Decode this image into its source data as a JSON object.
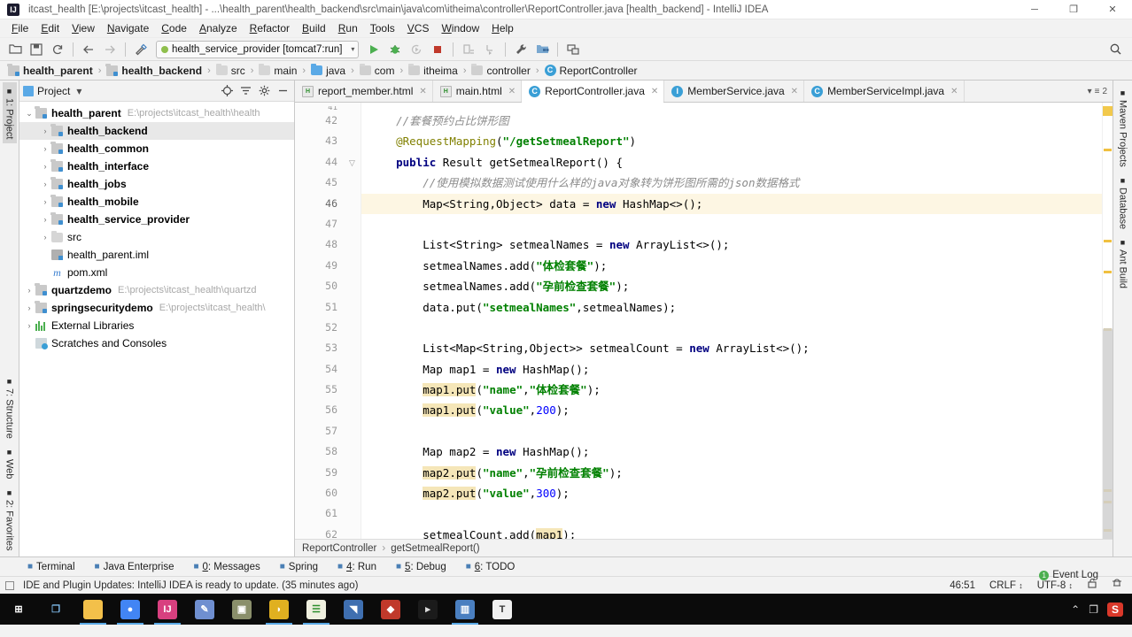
{
  "window": {
    "title": "itcast_health [E:\\projects\\itcast_health] - ...\\health_parent\\health_backend\\src\\main\\java\\com\\itheima\\controller\\ReportController.java [health_backend] - IntelliJ IDEA",
    "logo_text": "IJ",
    "minimize": "─",
    "maximize": "❐",
    "close": "✕"
  },
  "menu": [
    {
      "label": "File"
    },
    {
      "label": "Edit"
    },
    {
      "label": "View"
    },
    {
      "label": "Navigate"
    },
    {
      "label": "Code"
    },
    {
      "label": "Analyze"
    },
    {
      "label": "Refactor"
    },
    {
      "label": "Build"
    },
    {
      "label": "Run"
    },
    {
      "label": "Tools"
    },
    {
      "label": "VCS"
    },
    {
      "label": "Window"
    },
    {
      "label": "Help"
    }
  ],
  "toolbar": {
    "open_icon": "open-folder-icon",
    "save_icon": "save-all-icon",
    "sync_icon": "synchronize-icon",
    "back_icon": "back-arrow-icon",
    "forward_icon": "forward-arrow-icon",
    "build_icon": "build-hammer-icon",
    "run_config": "health_service_provider [tomcat7:run]",
    "run_icon": "run-icon",
    "debug_icon": "debug-icon",
    "run_coverage_icon": "run-with-coverage-icon",
    "stop_icon": "stop-icon",
    "update_app_icon": "update-application-icon",
    "profile_icon": "profile-icon",
    "settings_icon": "settings-wrench-icon",
    "project_structure_icon": "project-structure-icon",
    "sdk_icon": "sdk-manager-icon",
    "search_icon": "search-everywhere-icon"
  },
  "breadcrumbs": [
    {
      "label": "health_parent",
      "icon": "module-icon",
      "bold": true
    },
    {
      "label": "health_backend",
      "icon": "module-icon",
      "bold": true
    },
    {
      "label": "src",
      "icon": "folder-icon",
      "bold": false
    },
    {
      "label": "main",
      "icon": "folder-icon",
      "bold": false
    },
    {
      "label": "java",
      "icon": "source-folder-icon",
      "bold": false
    },
    {
      "label": "com",
      "icon": "package-icon",
      "bold": false
    },
    {
      "label": "itheima",
      "icon": "package-icon",
      "bold": false
    },
    {
      "label": "controller",
      "icon": "package-icon",
      "bold": false
    },
    {
      "label": "ReportController",
      "icon": "class-icon",
      "bold": false
    }
  ],
  "left_strip": {
    "top": [
      {
        "label": "1: Project",
        "icon": "project-icon",
        "active": true
      }
    ],
    "bottom": [
      {
        "label": "2: Favorites",
        "icon": "star-icon",
        "active": false
      },
      {
        "label": "Web",
        "icon": "web-icon",
        "active": false
      },
      {
        "label": "7: Structure",
        "icon": "structure-icon",
        "active": false
      }
    ]
  },
  "right_strip": [
    {
      "label": "Maven Projects",
      "icon": "maven-icon"
    },
    {
      "label": "Database",
      "icon": "database-icon"
    },
    {
      "label": "Ant Build",
      "icon": "ant-icon"
    }
  ],
  "project_panel": {
    "title": "Project",
    "title_caret": "▾",
    "buttons": [
      {
        "name": "locate-icon",
        "glyph": "⌘"
      },
      {
        "name": "collapse-all-icon",
        "glyph": "≡"
      },
      {
        "name": "settings-gear-icon",
        "glyph": "⚙"
      },
      {
        "name": "hide-icon",
        "glyph": "─"
      }
    ],
    "tree": [
      {
        "depth": 0,
        "arrow": "⌄",
        "icon": "module-icon",
        "label": "health_parent",
        "bold": true,
        "path": "E:\\projects\\itcast_health\\health",
        "selected": false
      },
      {
        "depth": 1,
        "arrow": "›",
        "icon": "module-icon",
        "label": "health_backend",
        "bold": true,
        "path": "",
        "selected": true
      },
      {
        "depth": 1,
        "arrow": "›",
        "icon": "module-icon",
        "label": "health_common",
        "bold": true,
        "path": "",
        "selected": false
      },
      {
        "depth": 1,
        "arrow": "›",
        "icon": "module-icon",
        "label": "health_interface",
        "bold": true,
        "path": "",
        "selected": false
      },
      {
        "depth": 1,
        "arrow": "›",
        "icon": "module-icon",
        "label": "health_jobs",
        "bold": true,
        "path": "",
        "selected": false
      },
      {
        "depth": 1,
        "arrow": "›",
        "icon": "module-icon",
        "label": "health_mobile",
        "bold": true,
        "path": "",
        "selected": false
      },
      {
        "depth": 1,
        "arrow": "›",
        "icon": "module-icon",
        "label": "health_service_provider",
        "bold": true,
        "path": "",
        "selected": false
      },
      {
        "depth": 1,
        "arrow": "›",
        "icon": "folder-icon",
        "label": "src",
        "bold": false,
        "path": "",
        "selected": false
      },
      {
        "depth": 1,
        "arrow": "",
        "icon": "iml-icon",
        "label": "health_parent.iml",
        "bold": false,
        "path": "",
        "selected": false
      },
      {
        "depth": 1,
        "arrow": "",
        "icon": "xml-icon",
        "label": "pom.xml",
        "bold": false,
        "path": "",
        "selected": false
      },
      {
        "depth": 0,
        "arrow": "›",
        "icon": "module-icon",
        "label": "quartzdemo",
        "bold": true,
        "path": "E:\\projects\\itcast_health\\quartzd",
        "selected": false
      },
      {
        "depth": 0,
        "arrow": "›",
        "icon": "module-icon",
        "label": "springsecuritydemo",
        "bold": true,
        "path": "E:\\projects\\itcast_health\\",
        "selected": false
      },
      {
        "depth": 0,
        "arrow": "›",
        "icon": "library-icon",
        "label": "External Libraries",
        "bold": false,
        "path": "",
        "selected": false
      },
      {
        "depth": 0,
        "arrow": "",
        "icon": "scratches-icon",
        "label": "Scratches and Consoles",
        "bold": false,
        "path": "",
        "selected": false
      }
    ]
  },
  "editor_tabs": [
    {
      "label": "report_member.html",
      "icon": "html-icon",
      "active": false,
      "close": "✕"
    },
    {
      "label": "main.html",
      "icon": "html-icon",
      "active": false,
      "close": "✕"
    },
    {
      "label": "ReportController.java",
      "icon": "class-icon",
      "active": true,
      "close": "✕"
    },
    {
      "label": "MemberService.java",
      "icon": "interface-icon",
      "active": false,
      "close": "✕"
    },
    {
      "label": "MemberServiceImpl.java",
      "icon": "class-icon",
      "active": false,
      "close": "✕"
    }
  ],
  "editor_tabs_right": {
    "label": "2",
    "icon": "tab-list-icon"
  },
  "code": {
    "first_line": 42,
    "lines": [
      {
        "n": 41,
        "partial": true,
        "highlight": false,
        "html": ""
      },
      {
        "n": 42,
        "highlight": false,
        "html": "    <span class='cmt'>//套餐预约占比饼形图</span>"
      },
      {
        "n": 43,
        "highlight": false,
        "html": "    <span class='ann'>@RequestMapping</span>(<span class='str'>\"/getSetmealReport\"</span>)"
      },
      {
        "n": 44,
        "highlight": false,
        "fold": true,
        "html": "    <span class='kw'>public</span> Result getSetmealReport() {"
      },
      {
        "n": 45,
        "highlight": false,
        "html": "        <span class='cmt'>//使用模拟数据测试使用什么样的java对象转为饼形图所需的json数据格式</span>"
      },
      {
        "n": 46,
        "highlight": true,
        "html": "        Map&lt;String,Object&gt; data = <span class='kw'>new</span> HashMap&lt;&gt;();"
      },
      {
        "n": 47,
        "highlight": false,
        "html": ""
      },
      {
        "n": 48,
        "highlight": false,
        "html": "        List&lt;String&gt; setmealNames = <span class='kw'>new</span> ArrayList&lt;&gt;();"
      },
      {
        "n": 49,
        "highlight": false,
        "html": "        setmealNames.add(<span class='str'>\"体检套餐\"</span>);"
      },
      {
        "n": 50,
        "highlight": false,
        "html": "        setmealNames.add(<span class='str'>\"孕前检查套餐\"</span>);"
      },
      {
        "n": 51,
        "highlight": false,
        "html": "        data.put(<span class='str'>\"setmealNames\"</span>,setmealNames);"
      },
      {
        "n": 52,
        "highlight": false,
        "html": ""
      },
      {
        "n": 53,
        "highlight": false,
        "html": "        List&lt;Map&lt;String,Object&gt;&gt; setmealCount = <span class='kw'>new</span> ArrayList&lt;&gt;();"
      },
      {
        "n": 54,
        "highlight": false,
        "html": "        Map map1 = <span class='kw'>new</span> HashMap();"
      },
      {
        "n": 55,
        "highlight": false,
        "html": "        <span class='mark'>map1.put</span>(<span class='str'>\"name\"</span>,<span class='str'>\"体检套餐\"</span>);"
      },
      {
        "n": 56,
        "highlight": false,
        "html": "        <span class='mark'>map1.put</span>(<span class='str'>\"value\"</span>,<span class='num'>200</span>);"
      },
      {
        "n": 57,
        "highlight": false,
        "html": ""
      },
      {
        "n": 58,
        "highlight": false,
        "html": "        Map map2 = <span class='kw'>new</span> HashMap();"
      },
      {
        "n": 59,
        "highlight": false,
        "html": "        <span class='mark'>map2.put</span>(<span class='str'>\"name\"</span>,<span class='str'>\"孕前检查套餐\"</span>);"
      },
      {
        "n": 60,
        "highlight": false,
        "html": "        <span class='mark'>map2.put</span>(<span class='str'>\"value\"</span>,<span class='num'>300</span>);"
      },
      {
        "n": 61,
        "highlight": false,
        "html": ""
      },
      {
        "n": 62,
        "highlight": false,
        "html": "        setmealCount.add(<span class='mark'>map1</span>);"
      }
    ]
  },
  "editor_breadcrumb": [
    {
      "label": "ReportController"
    },
    {
      "label": "getSetmealReport()"
    }
  ],
  "bottom_tools": [
    {
      "label": "Terminal",
      "icon": "terminal-icon",
      "mnemonic": ""
    },
    {
      "label": "Java Enterprise",
      "icon": "java-enterprise-icon",
      "mnemonic": ""
    },
    {
      "label": "0: Messages",
      "icon": "messages-icon",
      "mnemonic": "0"
    },
    {
      "label": "Spring",
      "icon": "spring-icon",
      "mnemonic": ""
    },
    {
      "label": "4: Run",
      "icon": "run-icon",
      "mnemonic": "4"
    },
    {
      "label": "5: Debug",
      "icon": "debug-icon",
      "mnemonic": "5"
    },
    {
      "label": "6: TODO",
      "icon": "todo-icon",
      "mnemonic": "6"
    }
  ],
  "status_bar": {
    "message": "IDE and Plugin Updates: IntelliJ IDEA is ready to update. (35 minutes ago)",
    "event_log": "Event Log",
    "position": "46:51",
    "line_separator": "CRLF",
    "encoding": "UTF-8",
    "separator_caret": "↕",
    "lock_icon": "unlocked-icon",
    "inspection_icon": "inspection-icon"
  },
  "taskbar": {
    "items": [
      {
        "name": "start-button",
        "glyph": "⊞",
        "color": "#ffffff",
        "bg": "transparent",
        "active": false
      },
      {
        "name": "task-view-icon",
        "glyph": "❐",
        "color": "#7db8e8",
        "bg": "transparent",
        "active": false
      },
      {
        "name": "file-explorer-icon",
        "glyph": "▬",
        "color": "#f3c04a",
        "bg": "#f3c04a",
        "active": true
      },
      {
        "name": "chrome-icon",
        "glyph": "●",
        "color": "#fff",
        "bg": "#4285f4",
        "active": true
      },
      {
        "name": "intellij-idea-icon",
        "glyph": "IJ",
        "color": "#fff",
        "bg": "#d8407f",
        "active": true
      },
      {
        "name": "paint-icon",
        "glyph": "✎",
        "color": "#fff",
        "bg": "#6f8fd0",
        "active": false
      },
      {
        "name": "photo-viewer-icon",
        "glyph": "▣",
        "color": "#fff",
        "bg": "#8a8f6b",
        "active": false
      },
      {
        "name": "navicat-icon",
        "glyph": "◗",
        "color": "#fff",
        "bg": "#e0b020",
        "active": true
      },
      {
        "name": "editplus-icon",
        "glyph": "☰",
        "color": "#2d8f2d",
        "bg": "#f0f0e0",
        "active": true
      },
      {
        "name": "charts-icon",
        "glyph": "◥",
        "color": "#fff",
        "bg": "#3f6fb0",
        "active": false
      },
      {
        "name": "redis-icon",
        "glyph": "◆",
        "color": "#fff",
        "bg": "#c0392b",
        "active": false
      },
      {
        "name": "cmd-icon",
        "glyph": "▸",
        "color": "#ddd",
        "bg": "#1b1b1b",
        "active": false
      },
      {
        "name": "app-window-icon",
        "glyph": "▥",
        "color": "#fff",
        "bg": "#4a7fc0",
        "active": true
      },
      {
        "name": "typora-icon",
        "glyph": "T",
        "color": "#333",
        "bg": "#f0f0f0",
        "active": false
      }
    ],
    "tray": [
      {
        "name": "show-hidden-icons",
        "glyph": "⌃"
      },
      {
        "name": "network-icon",
        "glyph": "❐"
      },
      {
        "name": "snipaste-icon",
        "glyph": "S"
      }
    ]
  }
}
